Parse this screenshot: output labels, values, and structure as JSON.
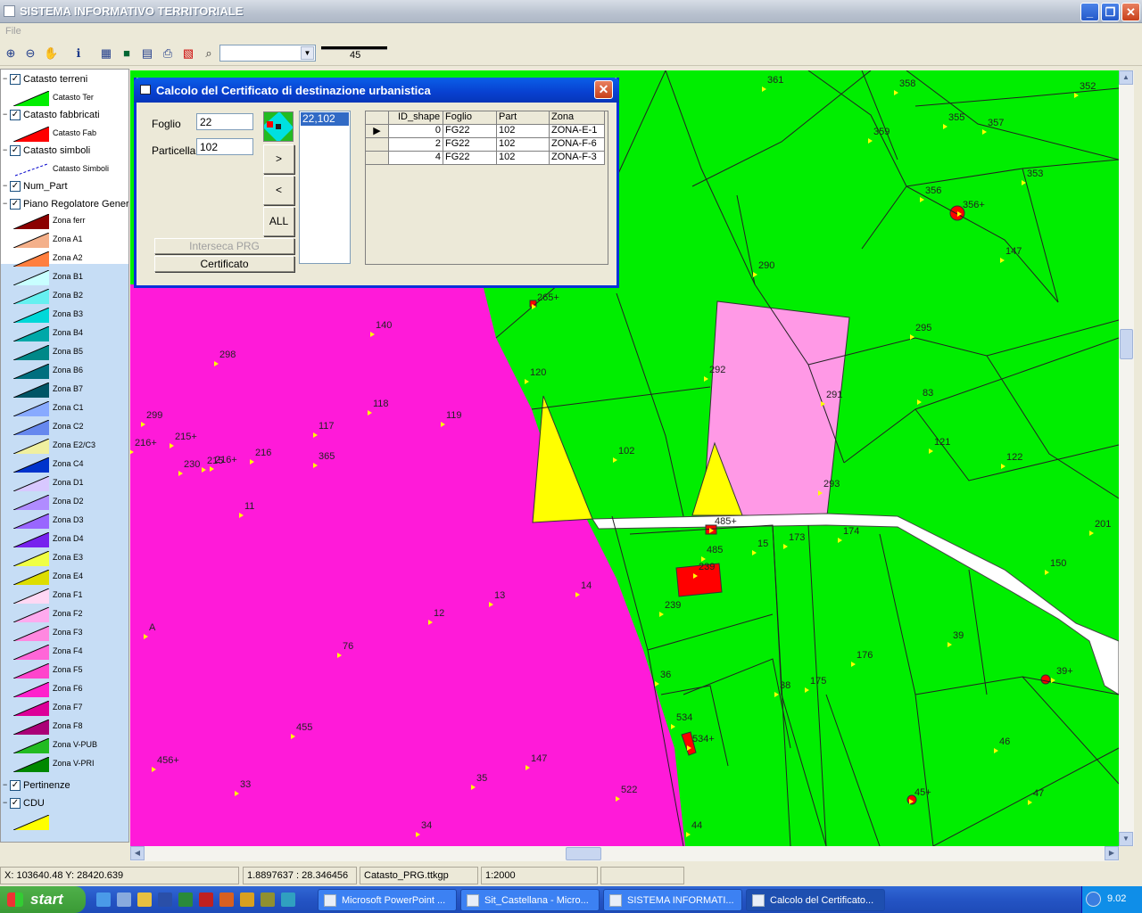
{
  "window": {
    "title": "SISTEMA INFORMATIVO TERRITORIALE"
  },
  "menu": {
    "file": "File"
  },
  "toolbar": {
    "scale_value": "45",
    "combo_value": ""
  },
  "legend": {
    "groups": [
      {
        "name": "Catasto terreni",
        "checked": "✓",
        "items": [
          {
            "name": "Catasto Ter",
            "color": "#00ee00"
          }
        ]
      },
      {
        "name": "Catasto fabbricati",
        "checked": "✓",
        "items": [
          {
            "name": "Catasto Fab",
            "color": "#ff0000"
          }
        ]
      },
      {
        "name": "Catasto simboli",
        "checked": "✓",
        "items": [
          {
            "name": "Catasto Simboli",
            "color": "#0000cc"
          }
        ]
      },
      {
        "name": "Num_Part",
        "checked": "✓"
      },
      {
        "name": "Piano Regolatore Generale",
        "checked": "✓"
      },
      {
        "name": "Pertinenze",
        "checked": "✓"
      },
      {
        "name": "CDU",
        "checked": "✓"
      }
    ],
    "prg_items": [
      {
        "name": "Zona ferr",
        "color": "#8b0000"
      },
      {
        "name": "Zona A1",
        "color": "#f4b08a"
      },
      {
        "name": "Zona A2",
        "color": "#ff7f3f"
      },
      {
        "name": "Zona B1",
        "color": "#c8ffff"
      },
      {
        "name": "Zona B2",
        "color": "#66f0f0"
      },
      {
        "name": "Zona B3",
        "color": "#00d8d8"
      },
      {
        "name": "Zona B4",
        "color": "#00a8a8"
      },
      {
        "name": "Zona B5",
        "color": "#008888"
      },
      {
        "name": "Zona B6",
        "color": "#006f7f"
      },
      {
        "name": "Zona B7",
        "color": "#005566"
      },
      {
        "name": "Zona C1",
        "color": "#88aaff"
      },
      {
        "name": "Zona C2",
        "color": "#6688ee"
      },
      {
        "name": "Zona E2/C3",
        "color": "#f0f0a0"
      },
      {
        "name": "Zona C4",
        "color": "#0033cc"
      },
      {
        "name": "Zona D1",
        "color": "#d8c8ff"
      },
      {
        "name": "Zona D2",
        "color": "#b08cff"
      },
      {
        "name": "Zona D3",
        "color": "#9966ff"
      },
      {
        "name": "Zona D4",
        "color": "#7722ee"
      },
      {
        "name": "Zona E3",
        "color": "#f0ff44"
      },
      {
        "name": "Zona E4",
        "color": "#dddd00"
      },
      {
        "name": "Zona F1",
        "color": "#ffd8f4"
      },
      {
        "name": "Zona F2",
        "color": "#ffaaee"
      },
      {
        "name": "Zona F3",
        "color": "#ff88e0"
      },
      {
        "name": "Zona F4",
        "color": "#ff66d8"
      },
      {
        "name": "Zona F5",
        "color": "#ff44cc"
      },
      {
        "name": "Zona F6",
        "color": "#ff22cc"
      },
      {
        "name": "Zona F7",
        "color": "#dd0099"
      },
      {
        "name": "Zona F8",
        "color": "#aa0077"
      },
      {
        "name": "Zona V-PUB",
        "color": "#22bb22"
      },
      {
        "name": "Zona V-PRI",
        "color": "#008800"
      }
    ],
    "cdu_color": "#ffff00"
  },
  "dialog": {
    "title": "Calcolo del Certificato di destinazione urbanistica",
    "foglio_label": "Foglio",
    "foglio_value": "22",
    "particella_label": "Particella",
    "particella_value": "102",
    "btn_add": ">",
    "btn_remove": "<",
    "btn_all": "ALL",
    "btn_interseca": "Interseca PRG",
    "btn_certificato": "Certificato",
    "list_items": [
      "22,102"
    ],
    "grid_headers": [
      "ID_shape",
      "Foglio",
      "Part",
      "Zona"
    ],
    "grid_rows": [
      {
        "marker": "▶",
        "id": "0",
        "foglio": "FG22",
        "part": "102",
        "zona": "ZONA-E-1"
      },
      {
        "marker": "",
        "id": "2",
        "foglio": "FG22",
        "part": "102",
        "zona": "ZONA-F-6"
      },
      {
        "marker": "",
        "id": "4",
        "foglio": "FG22",
        "part": "102",
        "zona": "ZONA-F-3"
      }
    ]
  },
  "map": {
    "colors": {
      "green": "#00ee00",
      "magenta": "#ff1ad9",
      "pink": "#ff99e6",
      "yellow": "#ffff00",
      "red": "#ff0000",
      "road": "#ffffff"
    },
    "labels": [
      "361",
      "358",
      "352",
      "355",
      "357",
      "359",
      "353",
      "356",
      "356+",
      "147",
      "290",
      "295",
      "292",
      "291",
      "83",
      "121",
      "122",
      "293",
      "201",
      "102",
      "120",
      "140",
      "298",
      "118",
      "119",
      "117",
      "299",
      "215+",
      "216+",
      "230",
      "215",
      "216",
      "365",
      "216+",
      "11",
      "485+",
      "485",
      "15",
      "173",
      "174",
      "150",
      "239",
      "239",
      "13",
      "14",
      "12",
      "A",
      "76",
      "39",
      "176",
      "36",
      "38",
      "175",
      "39+",
      "534",
      "534+",
      "46",
      "455",
      "147",
      "35",
      "456+",
      "33",
      "522",
      "45+",
      "47",
      "34",
      "44",
      "265+"
    ]
  },
  "status": {
    "coords": "X: 103640.48 Y: 28420.639",
    "geo": "1.8897637 :  28.346456",
    "file": "Catasto_PRG.ttkgp",
    "scale": "1:2000",
    "empty": ""
  },
  "taskbar": {
    "start": "start",
    "tasks": [
      "Microsoft PowerPoint ...",
      "Sit_Castellana - Micro...",
      "SISTEMA INFORMATI...",
      "Calcolo del Certificato..."
    ],
    "clock": "9.02"
  }
}
